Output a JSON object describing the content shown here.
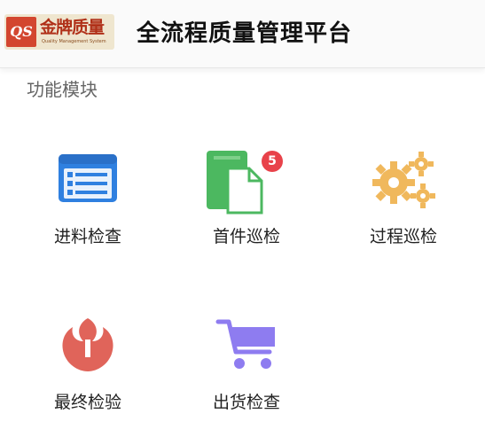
{
  "header": {
    "logo_badge": "QS",
    "logo_text": "金牌质量",
    "logo_subtext": "Quality Management System",
    "title": "全流程质量管理平台"
  },
  "section": {
    "title": "功能模块"
  },
  "modules": [
    {
      "label": "进料检查",
      "icon": "list-icon",
      "color": "#2f80e0"
    },
    {
      "label": "首件巡检",
      "icon": "document-icon",
      "color": "#4cb860",
      "badge": "5"
    },
    {
      "label": "过程巡检",
      "icon": "gears-icon",
      "color": "#f0b85c"
    },
    {
      "label": "最终检验",
      "icon": "rebel-emblem-icon",
      "color": "#e0645a"
    },
    {
      "label": "出货检查",
      "icon": "shopping-cart-icon",
      "color": "#8e7cf0"
    }
  ],
  "colors": {
    "badge": "#e8424a"
  }
}
